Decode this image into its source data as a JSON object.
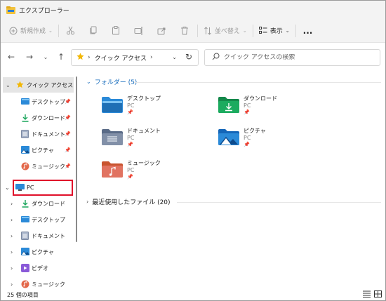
{
  "window": {
    "title": "エクスプローラー"
  },
  "toolbar": {
    "new_label": "新規作成",
    "sort_label": "並べ替え",
    "view_label": "表示",
    "more_label": "..."
  },
  "address": {
    "path": "クイック アクセス",
    "separator": "›"
  },
  "search": {
    "placeholder": "クイック アクセスの検索"
  },
  "sidebar": {
    "items": [
      {
        "label": "クイック アクセス"
      },
      {
        "label": "デスクトップ"
      },
      {
        "label": "ダウンロード"
      },
      {
        "label": "ドキュメント"
      },
      {
        "label": "ピクチャ"
      },
      {
        "label": "ミュージック"
      },
      {
        "label": "PC"
      },
      {
        "label": "ダウンロード"
      },
      {
        "label": "デスクトップ"
      },
      {
        "label": "ドキュメント"
      },
      {
        "label": "ピクチャ"
      },
      {
        "label": "ビデオ"
      },
      {
        "label": "ミュージック"
      }
    ]
  },
  "content": {
    "folders_header": "フォルダー (5)",
    "recent_header": "最近使用したファイル (20)",
    "folders": [
      {
        "name": "デスクトップ",
        "location": "PC"
      },
      {
        "name": "ダウンロード",
        "location": "PC"
      },
      {
        "name": "ドキュメント",
        "location": "PC"
      },
      {
        "name": "ピクチャ",
        "location": "PC"
      },
      {
        "name": "ミュージック",
        "location": "PC"
      }
    ]
  },
  "status": {
    "item_count": "25 個の項目"
  },
  "colors": {
    "accent": "#1a6ebd",
    "highlight_border": "#e0102a",
    "folder_yellow": "#f2c23c"
  }
}
